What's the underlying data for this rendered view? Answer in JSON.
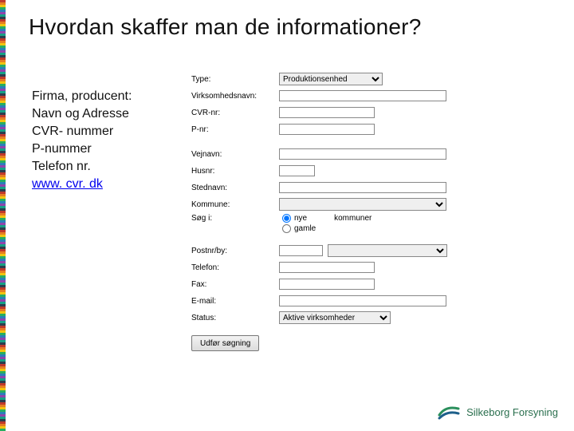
{
  "title": "Hvordan skaffer man de informationer?",
  "left": {
    "l1": "Firma, producent:",
    "l2": "Navn og Adresse",
    "l3": "CVR- nummer",
    "l4": "P-nummer",
    "l5": "Telefon nr.",
    "link": "www. cvr. dk"
  },
  "form": {
    "type_label": "Type:",
    "type_value": "Produktionsenhed",
    "virksomhedsnavn": "Virksomhedsnavn:",
    "cvrnr": "CVR-nr:",
    "pnr": "P-nr:",
    "vejnavn": "Vejnavn:",
    "husnr": "Husnr:",
    "stednavn": "Stednavn:",
    "kommune": "Kommune:",
    "sog_i": "Søg i:",
    "radio_nye": "nye",
    "radio_gamle": "gamle",
    "radio_extra": "kommuner",
    "postnr_by": "Postnr/by:",
    "telefon": "Telefon:",
    "fax": "Fax:",
    "email": "E-mail:",
    "status": "Status:",
    "status_value": "Aktive virksomheder",
    "button": "Udfør søgning"
  },
  "footer": {
    "brand": "Silkeborg Forsyning"
  }
}
